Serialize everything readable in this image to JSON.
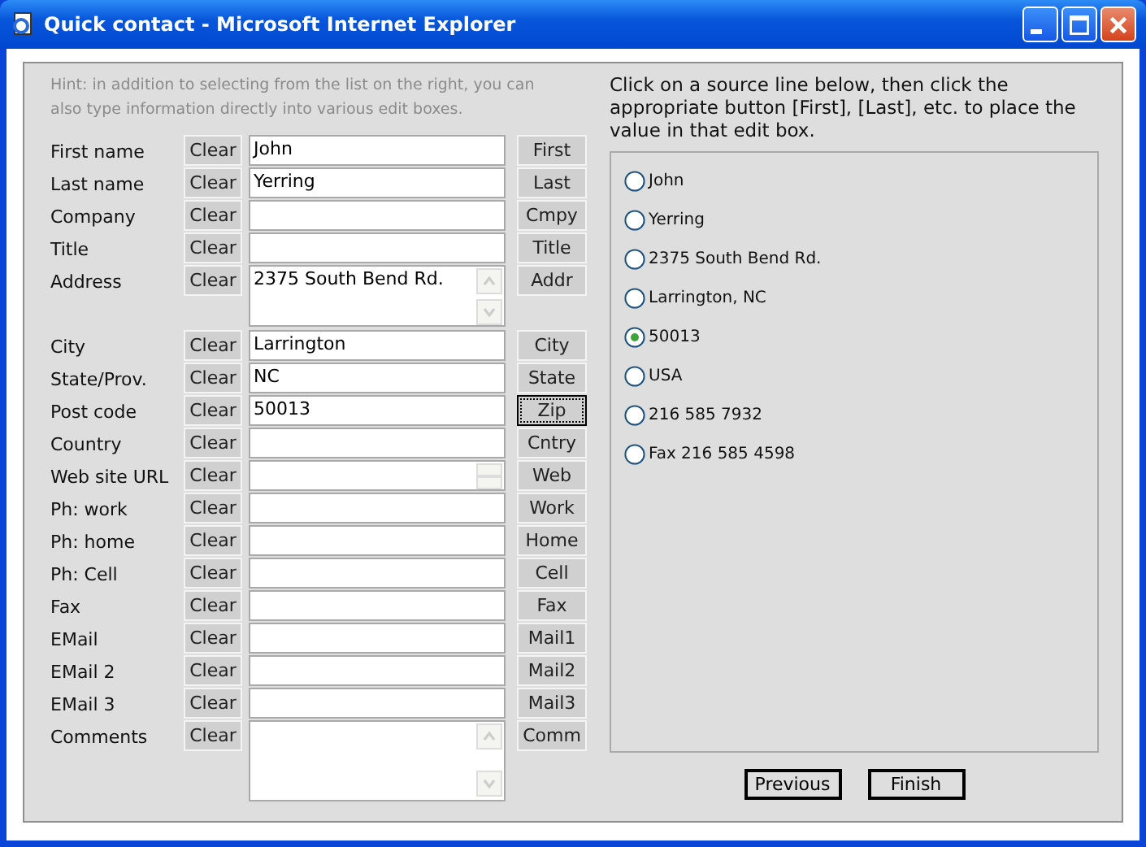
{
  "window": {
    "title": "Quick contact - Microsoft Internet Explorer"
  },
  "hint": "Hint: in addition to selecting from the list on the right, you can also type information directly into various edit boxes.",
  "instructions": "Click on a source line below, then click the appropriate button [First], [Last], etc. to place the value in that edit box.",
  "fields": [
    {
      "label": "First name",
      "clear": "Clear",
      "value": "John",
      "button": "First",
      "kind": "text",
      "focused": false
    },
    {
      "label": "Last name",
      "clear": "Clear",
      "value": "Yerring",
      "button": "Last",
      "kind": "text",
      "focused": false
    },
    {
      "label": "Company",
      "clear": "Clear",
      "button": "Cmpy",
      "kind": "text",
      "focused": false
    },
    {
      "label": "Title",
      "clear": "Clear",
      "button": "Title",
      "kind": "text",
      "focused": false
    },
    {
      "label": "Address",
      "clear": "Clear",
      "value": "2375 South Bend Rd.",
      "button": "Addr",
      "kind": "textarea",
      "focused": false
    },
    {
      "label": "City",
      "clear": "Clear",
      "value": "Larrington",
      "button": "City",
      "kind": "text",
      "focused": false
    },
    {
      "label": "State/Prov.",
      "clear": "Clear",
      "value": "NC",
      "button": "State",
      "kind": "text",
      "focused": false
    },
    {
      "label": "Post code",
      "clear": "Clear",
      "value": "50013",
      "button": "Zip",
      "kind": "text",
      "focused": true
    },
    {
      "label": "Country",
      "clear": "Clear",
      "button": "Cntry",
      "kind": "text",
      "focused": false
    },
    {
      "label": "Web site URL",
      "clear": "Clear",
      "button": "Web",
      "kind": "url",
      "focused": false
    },
    {
      "label": "Ph: work",
      "clear": "Clear",
      "button": "Work",
      "kind": "text",
      "focused": false
    },
    {
      "label": "Ph: home",
      "clear": "Clear",
      "button": "Home",
      "kind": "text",
      "focused": false
    },
    {
      "label": "Ph: Cell",
      "clear": "Clear",
      "button": "Cell",
      "kind": "text",
      "focused": false
    },
    {
      "label": "Fax",
      "clear": "Clear",
      "button": "Fax",
      "kind": "text",
      "focused": false
    },
    {
      "label": "EMail",
      "clear": "Clear",
      "button": "Mail1",
      "kind": "text",
      "focused": false
    },
    {
      "label": "EMail 2",
      "clear": "Clear",
      "button": "Mail2",
      "kind": "text",
      "focused": false
    },
    {
      "label": "EMail 3",
      "clear": "Clear",
      "button": "Mail3",
      "kind": "text",
      "focused": false
    },
    {
      "label": "Comments",
      "clear": "Clear",
      "button": "Comm",
      "kind": "comments",
      "focused": false
    }
  ],
  "sources": [
    {
      "text": "John",
      "selected": false
    },
    {
      "text": "Yerring",
      "selected": false
    },
    {
      "text": "2375 South Bend Rd.",
      "selected": false
    },
    {
      "text": "Larrington, NC",
      "selected": false
    },
    {
      "text": "50013",
      "selected": true
    },
    {
      "text": "USA",
      "selected": false
    },
    {
      "text": "216 585 7932",
      "selected": false
    },
    {
      "text": "Fax 216 585 4598",
      "selected": false
    }
  ],
  "buttons": [
    "Previous",
    "Finish"
  ]
}
